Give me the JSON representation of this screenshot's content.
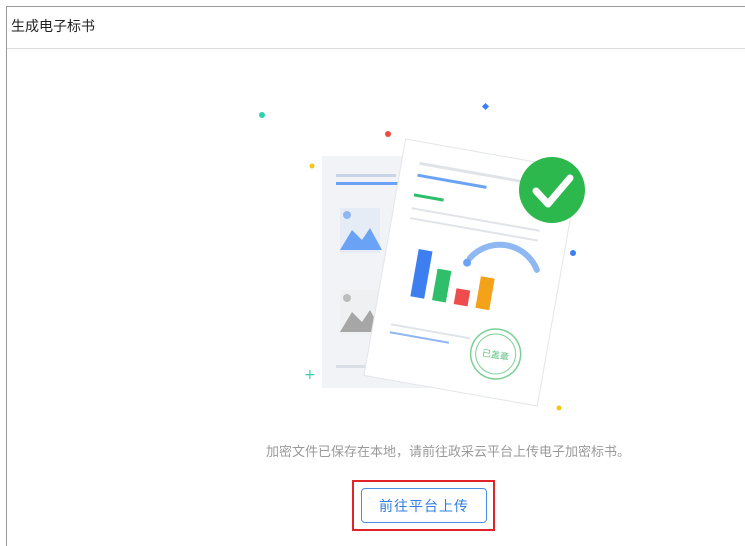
{
  "header": {
    "title": "生成电子标书"
  },
  "illustration": {
    "icon": "document-check-illustration",
    "stamp_text": "已盖章",
    "check_color": "#2db84d",
    "bar_colors": [
      "#3d7ef0",
      "#2fbf6a",
      "#ef4d4d",
      "#f5a21b"
    ]
  },
  "main": {
    "message": "加密文件已保存在本地，请前往政采云平台上传电子加密标书。",
    "upload_button_label": "前往平台上传"
  },
  "colors": {
    "accent": "#2f7fe0",
    "highlight_border": "#e0242a"
  }
}
